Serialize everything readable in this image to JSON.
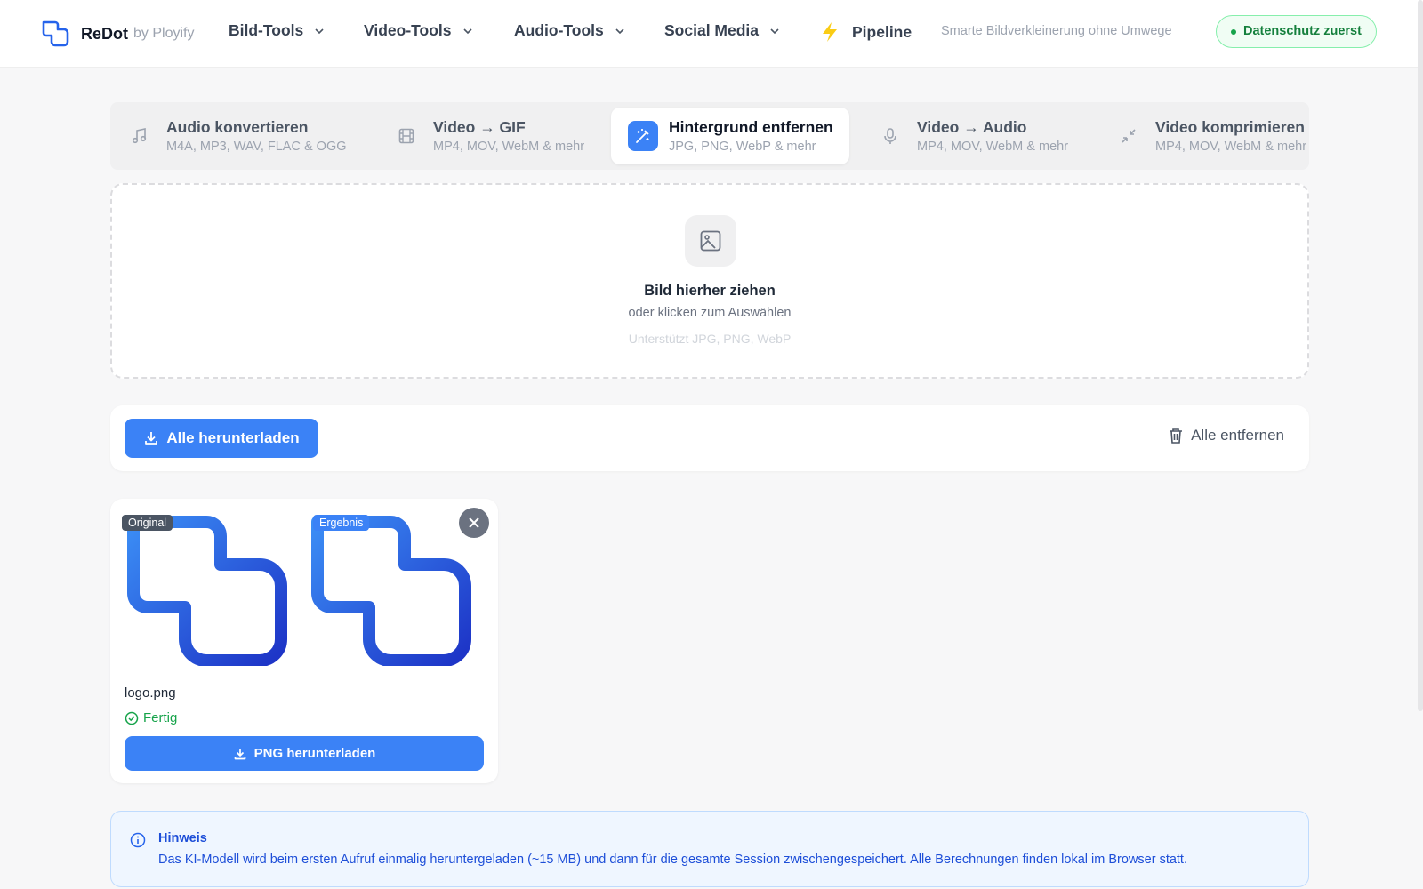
{
  "header": {
    "brand_name": "ReDot",
    "brand_by": "by Ployify",
    "nav": [
      {
        "label": "Bild-Tools"
      },
      {
        "label": "Video-Tools"
      },
      {
        "label": "Audio-Tools"
      },
      {
        "label": "Social Media"
      }
    ],
    "pipeline_label": "Pipeline",
    "tagline": "Smarte Bildverkleinerung ohne Umwege",
    "privacy_badge": "Datenschutz zuerst"
  },
  "tabs": [
    {
      "title": "Audio konvertieren",
      "subtitle": "M4A, MP3, WAV, FLAC & OGG",
      "icon": "music-note-icon"
    },
    {
      "title": "Video → GIF",
      "subtitle": "MP4, MOV, WebM & mehr",
      "icon": "film-icon"
    },
    {
      "title": "Hintergrund entfernen",
      "subtitle": "JPG, PNG, WebP & mehr",
      "icon": "magic-wand-icon",
      "active": true
    },
    {
      "title": "Video → Audio",
      "subtitle": "MP4, MOV, WebM & mehr",
      "icon": "microphone-icon"
    },
    {
      "title": "Video komprimieren",
      "subtitle": "MP4, MOV, WebM & mehr",
      "icon": "minimize-arrows-icon"
    }
  ],
  "dropzone": {
    "title": "Bild hierher ziehen",
    "subtitle": "oder klicken zum Auswählen",
    "hint": "Unterstützt JPG, PNG, WebP",
    "icon": "image-icon"
  },
  "actions": {
    "download_all": "Alle herunterladen",
    "remove_all": "Alle entfernen"
  },
  "file_card": {
    "original_label": "Original",
    "result_label": "Ergebnis",
    "filename": "logo.png",
    "status": "Fertig",
    "download_button": "PNG herunterladen"
  },
  "notice": {
    "title": "Hinweis",
    "body": "Das KI-Modell wird beim ersten Aufruf einmalig heruntergeladen (~15 MB) und dann für die gesamte Session zwischengespeichert. Alle Berechnungen finden lokal im Browser statt."
  },
  "colors": {
    "accent": "#3b82f6",
    "success": "#16a34a",
    "privacy_bg": "#f0fdf4",
    "notice_bg": "#eff6ff"
  }
}
